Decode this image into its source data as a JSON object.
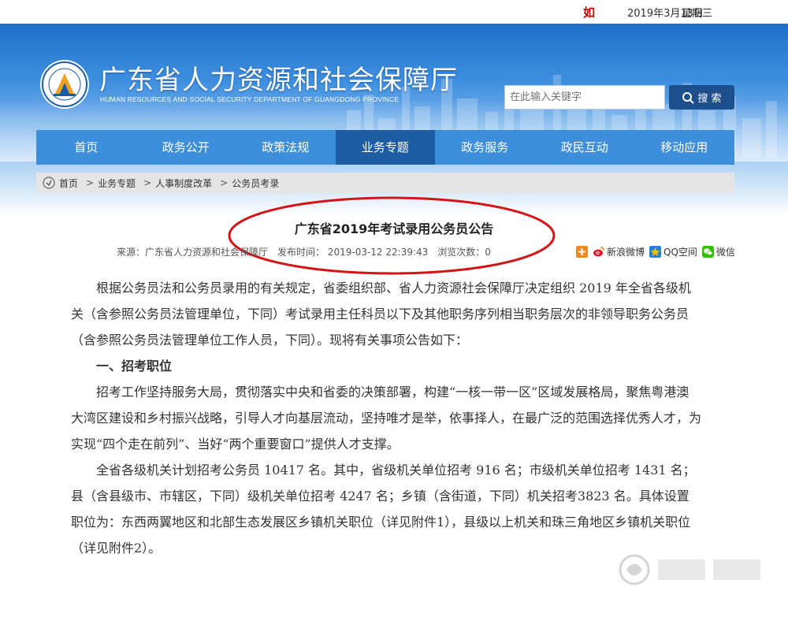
{
  "topbar": {
    "mark": "如",
    "date": "2019年3月13日",
    "weekday": "星期三"
  },
  "header": {
    "title": "广东省人力资源和社会保障厅",
    "subtitle": "HUMAN RESOURCES AND SOCIAL SECURITY DEPARTMENT OF GUANGDONG PROVINCE"
  },
  "search": {
    "placeholder": "在此输入关键字",
    "button_label": "搜 索"
  },
  "nav": {
    "items": [
      {
        "label": "首页"
      },
      {
        "label": "政务公开"
      },
      {
        "label": "政策法规"
      },
      {
        "label": "业务专题"
      },
      {
        "label": "政务服务"
      },
      {
        "label": "政民互动"
      },
      {
        "label": "移动应用"
      }
    ],
    "active_index": 3
  },
  "breadcrumb": {
    "items": [
      "首页",
      "业务专题",
      "人事制度改革",
      "公务员考录"
    ],
    "separator": ">"
  },
  "article": {
    "title": "广东省2019年考试录用公务员公告",
    "source": "来源：广东省人力资源和社会保障厅",
    "publish_time": "发布时间： 2019-03-12 22:39:43",
    "views": "浏览次数：0",
    "paragraphs": [
      "根据公务员法和公务员录用的有关规定，省委组织部、省人力资源社会保障厅决定组织 2019 年全省各级机关（含参照公务员法管理单位，下同）考试录用主任科员以下及其他职务序列相当职务层次的非领导职务公务员（含参照公务员法管理单位工作人员，下同）。现将有关事项公告如下：",
      "一、招考职位",
      "招考工作坚持服务大局，贯彻落实中央和省委的决策部署，构建“一核一带一区”区域发展格局，聚焦粤港澳大湾区建设和乡村振兴战略，引导人才向基层流动，坚持唯才是举，依事择人，在最广泛的范围选择优秀人才，为实现“四个走在前列”、当好“两个重要窗口”提供人才支撑。",
      "全省各级机关计划招考公务员 10417 名。其中，省级机关单位招考 916 名；市级机关单位招考 1431 名；县（含县级市、市辖区，下同）级机关单位招考 4247 名；乡镇（含街道，下同）机关招考3823 名。具体设置职位为：东西两翼地区和北部生态发展区乡镇机关职位（详见附件1），县级以上机关和珠三角地区乡镇机关职位（详见附件2）。"
    ]
  },
  "share": {
    "items": [
      {
        "label": "",
        "icon": "plus-share-icon",
        "color": "#f08a1c"
      },
      {
        "label": "新浪微博",
        "icon": "weibo-icon",
        "color": "#e6162d"
      },
      {
        "label": "QQ空间",
        "icon": "qzone-icon",
        "color": "#f6c100"
      },
      {
        "label": "微信",
        "icon": "wechat-icon",
        "color": "#2dc100"
      }
    ]
  },
  "colors": {
    "nav_bg": "#3d8fdb",
    "nav_active": "#1e5ca3",
    "search_button": "#1d4f8c",
    "annotation": "#d41515"
  }
}
